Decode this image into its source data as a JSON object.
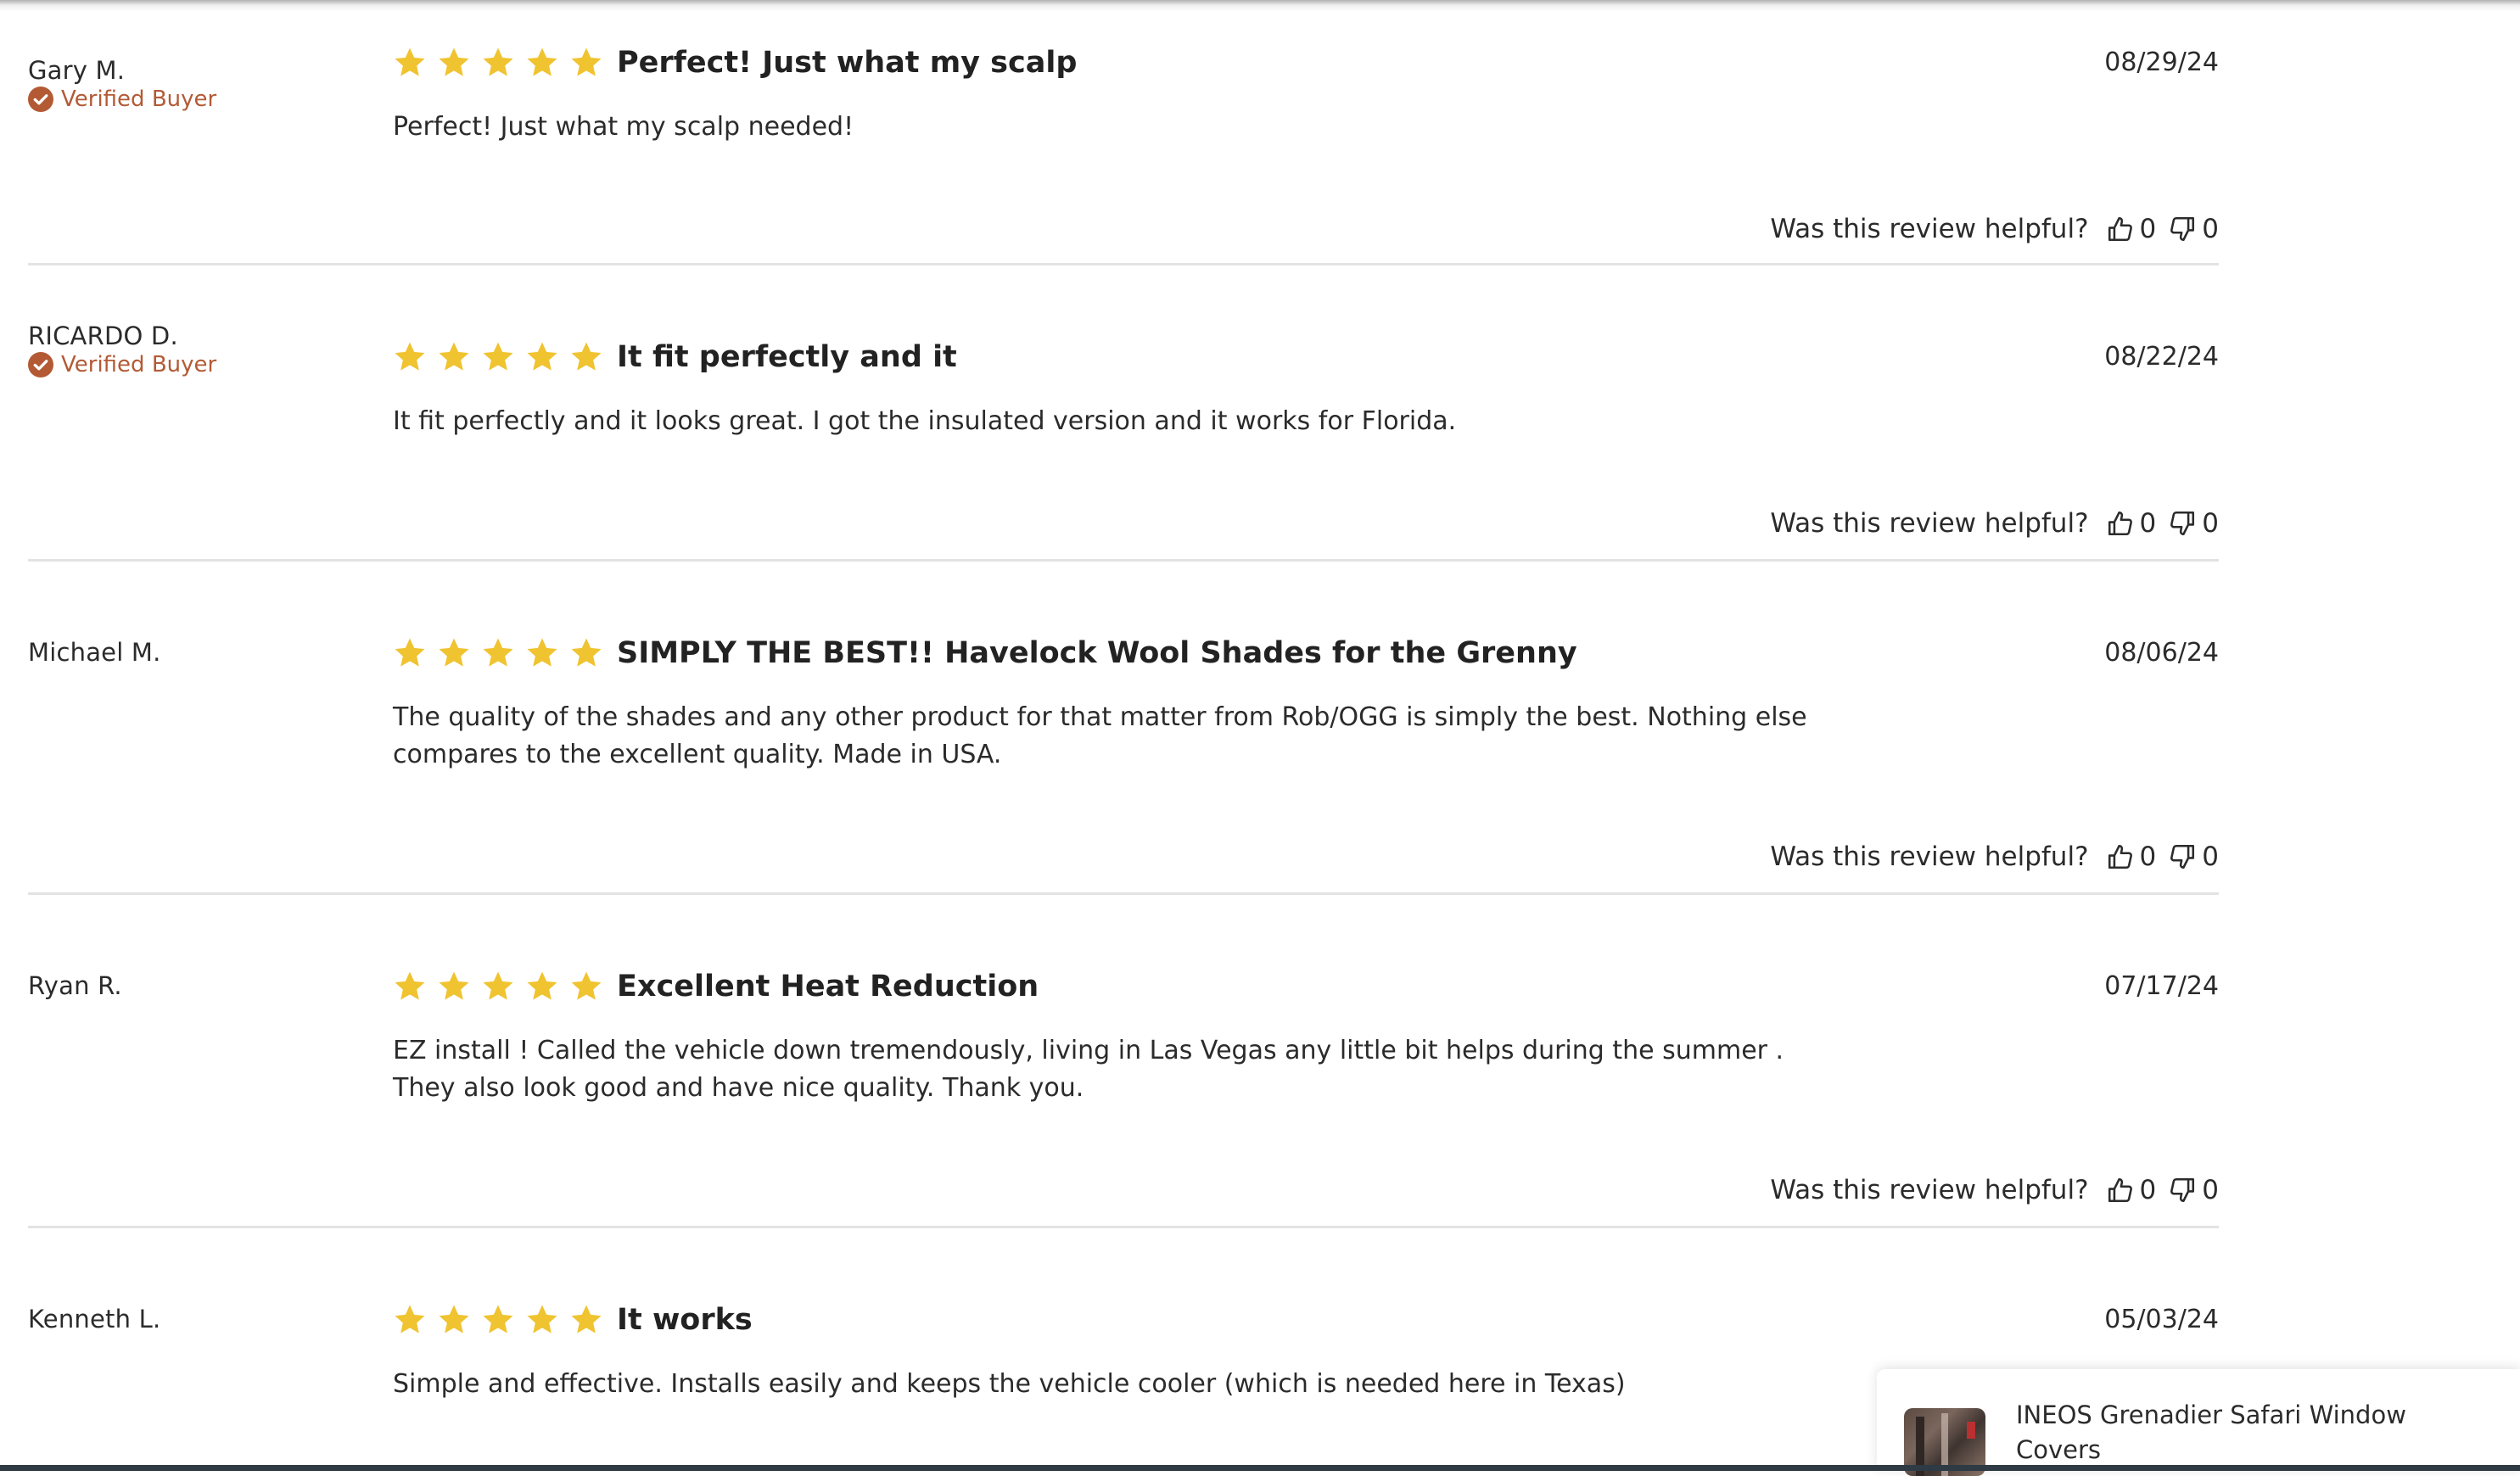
{
  "colors": {
    "star": "#f0c330",
    "verified": "#b35a35",
    "divider": "#e3e3e3",
    "bottom_bar": "#2e3a44"
  },
  "icons": {
    "star": "star-icon",
    "verified": "check-circle-icon",
    "upvote": "thumbs-up-icon",
    "downvote": "thumbs-down-icon"
  },
  "helpful_prompt": "Was this review helpful?",
  "verified_label": "Verified Buyer",
  "reviews": [
    {
      "name": "Gary M.",
      "verified": true,
      "rating": 5,
      "title": "Perfect! Just what my scalp",
      "date": "08/29/24",
      "body": "Perfect! Just what my scalp needed!",
      "up": "0",
      "down": "0"
    },
    {
      "name": "RICARDO D.",
      "verified": true,
      "rating": 5,
      "title": "It fit perfectly and it",
      "date": "08/22/24",
      "body": "It fit perfectly and it looks great. I got the insulated version and it works for Florida.",
      "up": "0",
      "down": "0"
    },
    {
      "name": "Michael M.",
      "verified": false,
      "rating": 5,
      "title": "SIMPLY THE BEST!! Havelock Wool Shades for the Grenny",
      "date": "08/06/24",
      "body": "The quality of the shades and any other product for that matter from Rob/OGG is simply the best. Nothing else compares to the excellent quality. Made in USA.",
      "up": "0",
      "down": "0"
    },
    {
      "name": "Ryan R.",
      "verified": false,
      "rating": 5,
      "title": "Excellent Heat Reduction",
      "date": "07/17/24",
      "body": "EZ install ! Called the vehicle down tremendously, living in Las Vegas any little bit helps during the summer . They also look good and have nice quality. Thank you.",
      "up": "0",
      "down": "0"
    },
    {
      "name": "Kenneth L.",
      "verified": false,
      "rating": 5,
      "title": "It works",
      "date": "05/03/24",
      "body": "Simple and effective. Installs easily and keeps the vehicle cooler (which is needed here in Texas)"
    }
  ],
  "product_card": {
    "name": "INEOS Grenadier Safari Window Covers"
  }
}
